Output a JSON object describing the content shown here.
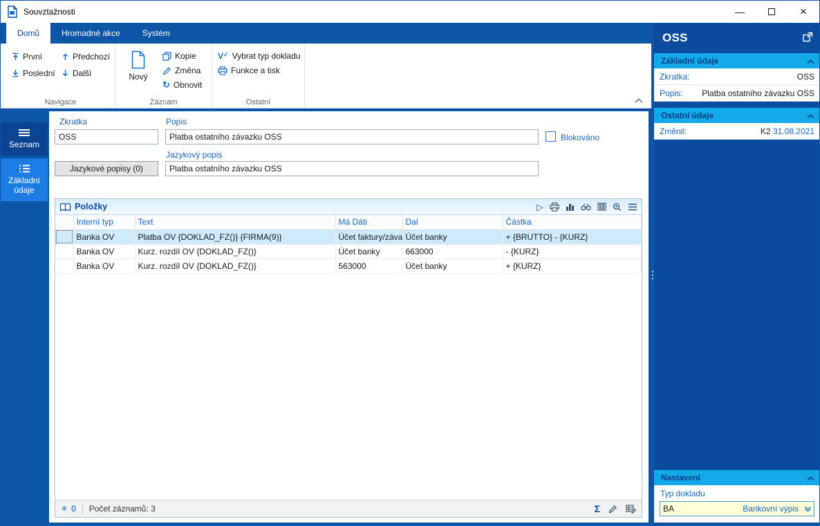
{
  "window": {
    "title": "Souvztažnosti"
  },
  "icons": {
    "close": "×",
    "minimize": "—",
    "refresh": "↻",
    "check": "✓",
    "v_letter": "V",
    "play": "▷",
    "sum": "Σ",
    "asterisk": "✳"
  },
  "ribbon": {
    "tabs": [
      {
        "label": "Domů"
      },
      {
        "label": "Hromadné akce"
      },
      {
        "label": "Systém"
      }
    ],
    "navigace": {
      "label": "Navigace",
      "items": [
        "První",
        "Poslední",
        "Předchozí",
        "Další"
      ]
    },
    "zaznam": {
      "label": "Záznam",
      "novy": "Nový",
      "kopie": "Kopie",
      "zmena": "Změna",
      "obnovit": "Obnovit"
    },
    "ostatni": {
      "label": "Ostatní",
      "vybrat_typ_dokladu": "Vybrat typ dokladu",
      "funkce_a_tisk": "Funkce a tisk"
    }
  },
  "sidebar": {
    "seznam": "Seznam",
    "zakladni_udaje": "Základní údaje"
  },
  "form": {
    "zkratka_label": "Zkratka",
    "zkratka_value": "OSS",
    "popis_label": "Popis",
    "popis_value": "Platba ostatního závazku OSS",
    "blokovano_label": "Blokováno",
    "jazykove_popisy_button": "Jazykové popisy (0)",
    "jazykovy_popis_label": "Jazykový popis",
    "jazykovy_popis_value": "Platba ostatního závazku OSS"
  },
  "polozky": {
    "title": "Položky",
    "columns": [
      "Interní typ",
      "Text",
      "Má Dáti",
      "Dal",
      "Částka"
    ],
    "rows": [
      [
        "Banka OV",
        "Platba OV {DOKLAD_FZ()} {FIRMA(9)}",
        "Účet faktury/závaz...",
        "Účet banky",
        "+ {BRUTTO} - {KURZ}"
      ],
      [
        "Banka OV",
        "Kurz. rozdíl OV {DOKLAD_FZ()}",
        "Účet banky",
        "663000",
        "- {KURZ}"
      ],
      [
        "Banka OV",
        "Kurz. rozdíl OV {DOKLAD_FZ()}",
        "563000",
        "Účet banky",
        "+ {KURZ}"
      ]
    ],
    "status_counter": "0",
    "status_count": "Počet záznamů: 3"
  },
  "right_panel": {
    "title": "OSS",
    "zakladni_udaje": {
      "header": "Základní údaje",
      "rows": [
        {
          "label": "Zkratka:",
          "value": "OSS"
        },
        {
          "label": "Popis:",
          "value": "Platba ostatního závazku OSS"
        }
      ]
    },
    "ostatni_udaje": {
      "header": "Ostatní údaje",
      "zmenil_label": "Změnil:",
      "user": "K2",
      "date": "31.08.2021"
    },
    "nastaveni": {
      "header": "Nastavení",
      "typ_dokladu": "Typ dokladu",
      "code": "BA",
      "value": "Bankovní výpis"
    }
  },
  "colors": {
    "accent_blue": "#0d55a6",
    "header_cyan": "#14aae9",
    "selection": "#cfeafb",
    "label_blue": "#1565c0"
  }
}
